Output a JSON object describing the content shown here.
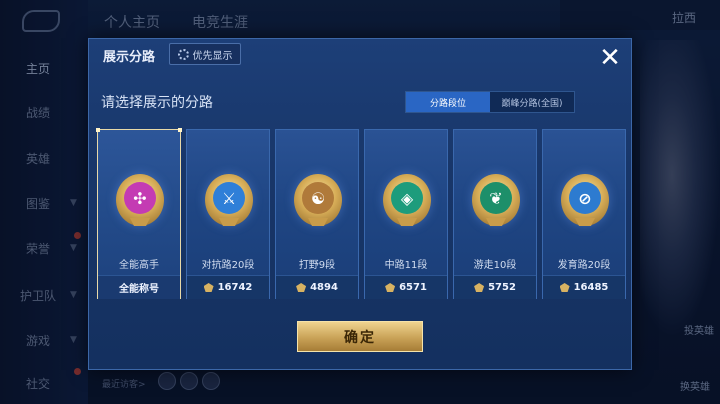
{
  "background": {
    "top_tabs": [
      "个人主页",
      "电竞生涯"
    ],
    "sidebar": [
      {
        "label": "主页",
        "active": true
      },
      {
        "label": "战绩"
      },
      {
        "label": "英雄"
      },
      {
        "label": "图鉴"
      },
      {
        "label": "荣誉"
      },
      {
        "label": "护卫队"
      },
      {
        "label": "游戏"
      },
      {
        "label": "社交"
      }
    ],
    "top_right_text": "拉西",
    "bottom_visitors_label": "最近访客>",
    "right_buttons": [
      "投英雄",
      "换英雄"
    ]
  },
  "modal": {
    "title": "展示分路",
    "priority_button": "优先显示",
    "prompt": "请选择展示的分路",
    "toggle_options": [
      {
        "label": "分路段位",
        "active": true
      },
      {
        "label": "巅峰分路(全国)",
        "active": false
      }
    ],
    "cards": [
      {
        "name": "全能高手",
        "footer": "全能称号",
        "selected": true,
        "badge_color": "#c43bb3",
        "badge_glyph": "✣"
      },
      {
        "name": "对抗路20段",
        "score": "16742",
        "badge_color": "#2f7fd8",
        "badge_glyph": "⚔"
      },
      {
        "name": "打野9段",
        "score": "4894",
        "badge_color": "#b07a3a",
        "badge_glyph": "☯"
      },
      {
        "name": "中路11段",
        "score": "6571",
        "badge_color": "#1d9c7c",
        "badge_glyph": "◈"
      },
      {
        "name": "游走10段",
        "score": "5752",
        "badge_color": "#1d8f6a",
        "badge_glyph": "❦"
      },
      {
        "name": "发育路20段",
        "score": "16485",
        "badge_color": "#2d7bd0",
        "badge_glyph": "⊘"
      }
    ],
    "confirm_button": "确定"
  }
}
